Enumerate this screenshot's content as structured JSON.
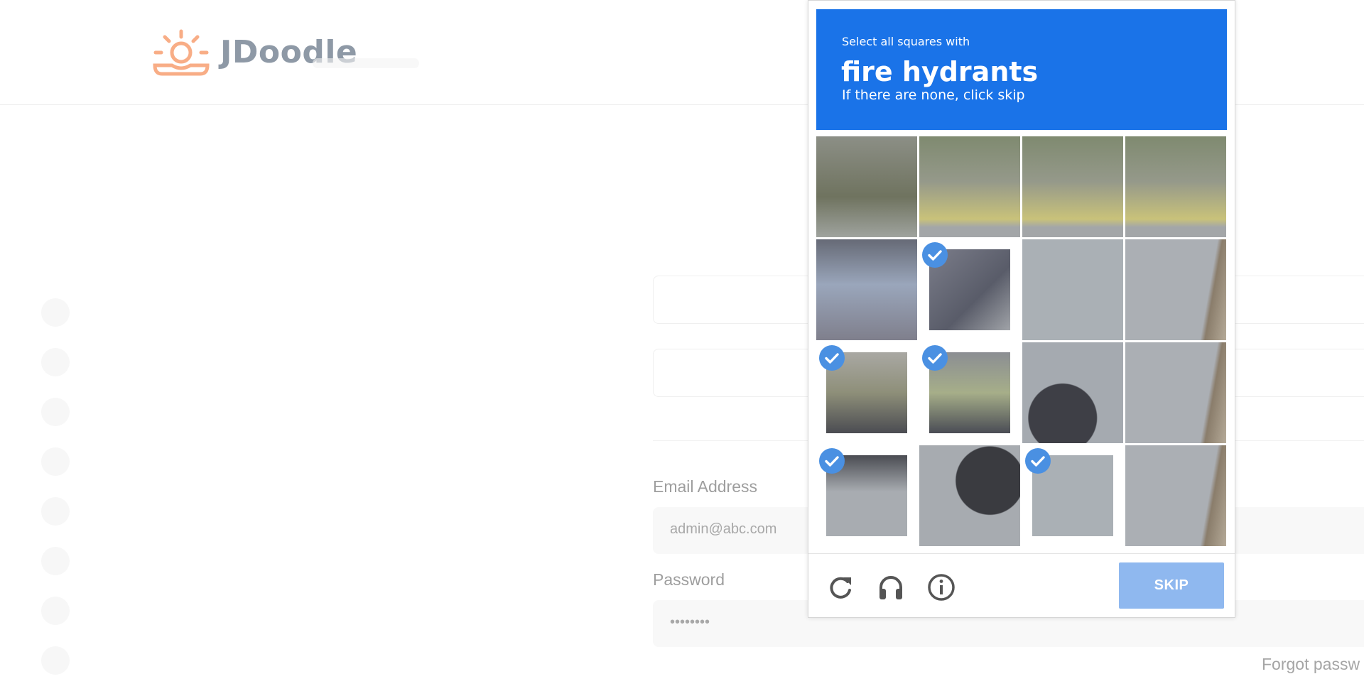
{
  "app": {
    "logo_text": "JDoodle",
    "brand_color": "#f48c5a"
  },
  "login_form": {
    "email_label": "Email Address",
    "email_value": "admin@abc.com",
    "password_label": "Password",
    "password_value": "••••••••",
    "forgot_link": "Forgot passw"
  },
  "captcha": {
    "instruction": "Select all squares with",
    "target": "fire hydrants",
    "hint": "If there are none, click skip",
    "header_color": "#1a73e8",
    "grid_size": "4x4",
    "selected_tiles": [
      [
        1,
        1
      ],
      [
        2,
        0
      ],
      [
        2,
        1
      ],
      [
        3,
        0
      ],
      [
        3,
        2
      ]
    ],
    "footer": {
      "reload_icon": "reload-icon",
      "audio_icon": "headphones-icon",
      "info_icon": "info-icon",
      "skip_label": "SKIP"
    }
  }
}
